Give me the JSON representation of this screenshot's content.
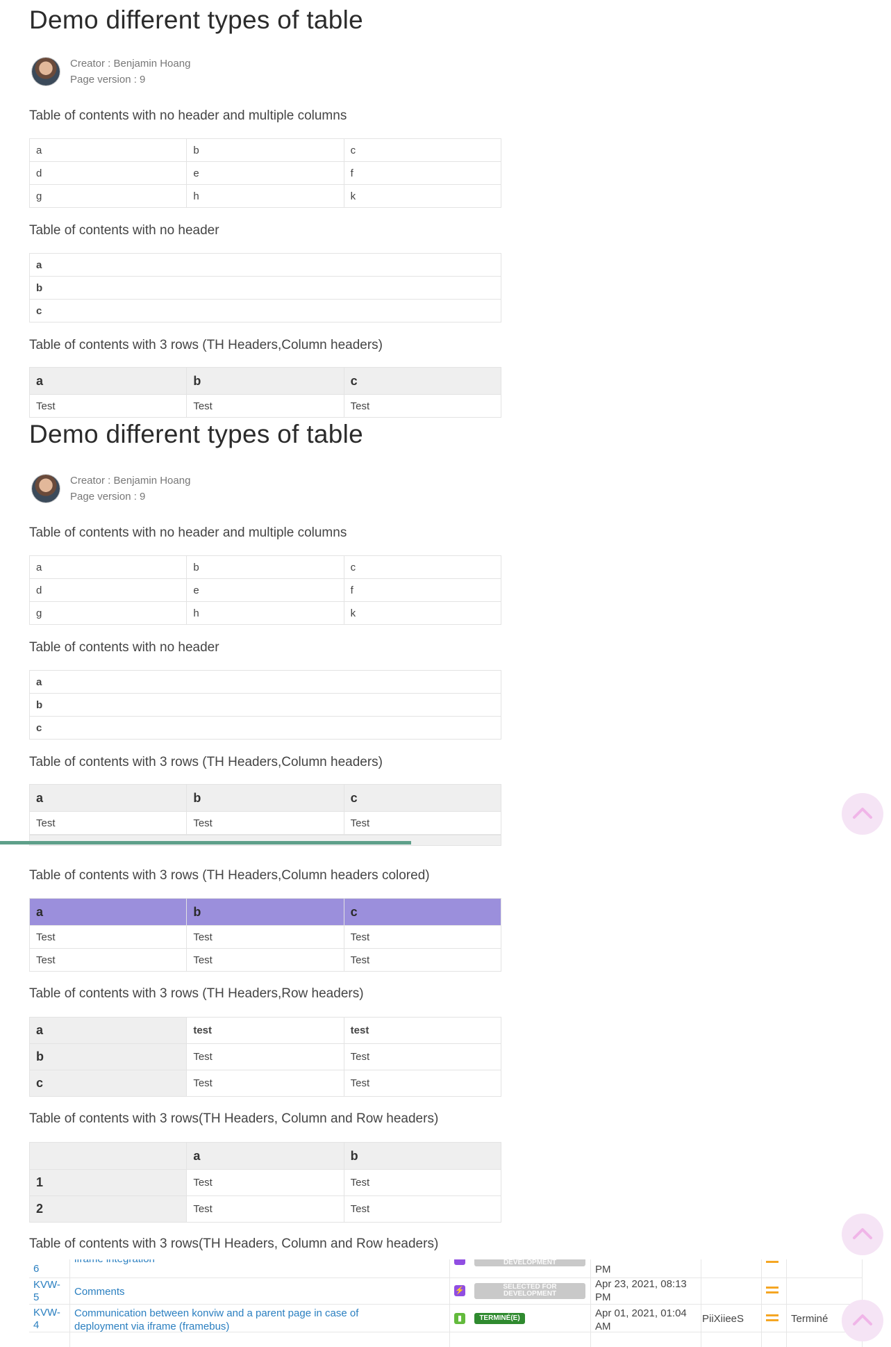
{
  "page": {
    "title": "Demo different types of table",
    "creator": "Creator : Benjamin Hoang",
    "version": "Page version : 9"
  },
  "captions": {
    "multi_no_header": "Table of contents with no header and multiple columns",
    "no_header": "Table of contents with no header",
    "th_column": "Table of contents with 3 rows (TH Headers,Column headers)",
    "th_column_colored": "Table of contents with 3 rows (TH Headers,Column headers colored)",
    "th_row": "Table of contents with 3 rows (TH Headers,Row headers)",
    "th_col_row": "Table of contents with 3 rows(TH Headers, Column and Row headers)"
  },
  "tables": {
    "multi": [
      [
        "a",
        "b",
        "c"
      ],
      [
        "d",
        "e",
        "f"
      ],
      [
        "g",
        "h",
        "k"
      ]
    ],
    "single": [
      "a",
      "b",
      "c"
    ],
    "th_column": {
      "headers": [
        "a",
        "b",
        "c"
      ],
      "rows": [
        [
          "Test",
          "Test",
          "Test"
        ]
      ]
    },
    "th_column_colored": {
      "headers": [
        "a",
        "b",
        "c"
      ],
      "rows": [
        [
          "Test",
          "Test",
          "Test"
        ],
        [
          "Test",
          "Test",
          "Test"
        ]
      ],
      "header_color": "#9b8fdc"
    },
    "th_row": {
      "rows": [
        {
          "h": "a",
          "cells": [
            "test",
            "test"
          ]
        },
        {
          "h": "b",
          "cells": [
            "Test",
            "Test"
          ]
        },
        {
          "h": "c",
          "cells": [
            "Test",
            "Test"
          ]
        }
      ]
    },
    "th_col_row": {
      "headers": [
        "",
        "a",
        "b"
      ],
      "rows": [
        {
          "h": "1",
          "cells": [
            "Test",
            "Test"
          ]
        },
        {
          "h": "2",
          "cells": [
            "Test",
            "Test"
          ]
        }
      ]
    }
  },
  "issues": [
    {
      "key_line1": "6",
      "summary": "iframe integration",
      "status": "DEVELOPMENT",
      "date_line2": "PM"
    },
    {
      "key_line1": "KVW-",
      "key_line2": "5",
      "summary": "Comments",
      "status_line1": "SELECTED FOR",
      "status_line2": "DEVELOPMENT",
      "date_line1": "Apr 23, 2021, 08:13",
      "date_line2": "PM"
    },
    {
      "key_line1": "KVW-",
      "key_line2": "4",
      "summary_line1": "Communication between konviw and a parent page in case of",
      "summary_line2": "deployment via iframe (framebus)",
      "status": "TERMINÉ(E)",
      "date_line1": "Apr 01, 2021, 01:04",
      "date_line2": "AM",
      "assignee": "PiiXiieeS",
      "resolution": "Terminé"
    }
  ],
  "colors": {
    "accent_green": "#5ea08a",
    "scroll_button": "#f5e4f5",
    "priority": "#f5a623",
    "link": "#2a7fc0"
  }
}
